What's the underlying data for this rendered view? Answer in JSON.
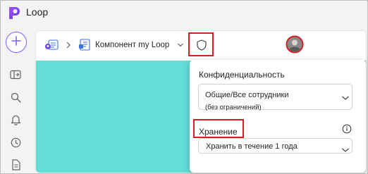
{
  "app": {
    "title": "Loop",
    "accent_color": "#7b61ff",
    "highlight_color": "#d42027"
  },
  "rail": {
    "items": [
      {
        "name": "new-button",
        "icon": "plus-icon"
      },
      {
        "name": "panel-toggle",
        "icon": "sidebar-panel-icon"
      },
      {
        "name": "search",
        "icon": "search-icon"
      },
      {
        "name": "notifications",
        "icon": "bell-icon"
      },
      {
        "name": "recent",
        "icon": "clock-icon"
      },
      {
        "name": "pages",
        "icon": "document-icon"
      }
    ]
  },
  "toolbar": {
    "breadcrumb_label": "Компонент my Loop",
    "icons": [
      "loop-workspace-icon",
      "chevron-right-icon",
      "loop-component-icon",
      "chevron-down-icon",
      "shield-icon",
      "avatar"
    ]
  },
  "canvas": {
    "color": "#63ddd5"
  },
  "popup": {
    "sensitivity_label": "Конфиденциальность",
    "sensitivity_value": "Общие/Все сотрудники",
    "sensitivity_subvalue": "(без ограничений)",
    "retention_label": "Хранение",
    "retention_value": "Хранить в течение 1 года"
  }
}
